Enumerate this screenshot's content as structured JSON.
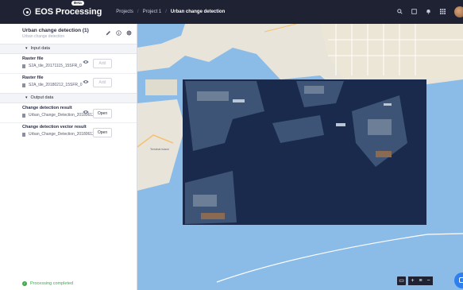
{
  "app": {
    "logo_text": "EOS Processing",
    "beta_badge": "Beta"
  },
  "breadcrumb": {
    "items": [
      "Projects",
      "Project 1",
      "Urban change detection"
    ],
    "separator": "/"
  },
  "topbar_icons": [
    "search-icon",
    "square-icon",
    "bell-icon",
    "apps-grid-icon",
    "user-avatar"
  ],
  "process": {
    "title": "Urban change detection (1)",
    "subtitle": "Urban change detection"
  },
  "sections": {
    "input": "Input data",
    "output": "Output data"
  },
  "inputs": [
    {
      "label": "Raster file",
      "file": "S2A_tile_20171115_15SFR_0",
      "button": "Add"
    },
    {
      "label": "Raster file",
      "file": "S2A_tile_20180212_15SFR_0",
      "button": "Add"
    }
  ],
  "outputs": [
    {
      "label": "Change detection result",
      "file": "Urban_Change_Detection_20180612...",
      "button": "Open"
    },
    {
      "label": "Change detection vector result",
      "file": "Urban_Change_Detection_20180612_107...",
      "button": "Open"
    }
  ],
  "status": {
    "text": "Processing completed",
    "color": "#3daa4c"
  },
  "map": {
    "labels": {
      "terminal_island": "Terminal Island"
    },
    "controls": {
      "zoom_in": "+",
      "zoom_out": "−",
      "layers": "▭",
      "menu": "≡"
    }
  },
  "colors": {
    "topbar": "#1e2233",
    "water": "#8bbce8",
    "land": "#e9e4da",
    "imagery": "#1a2a4d",
    "accent": "#2d7ff0"
  }
}
